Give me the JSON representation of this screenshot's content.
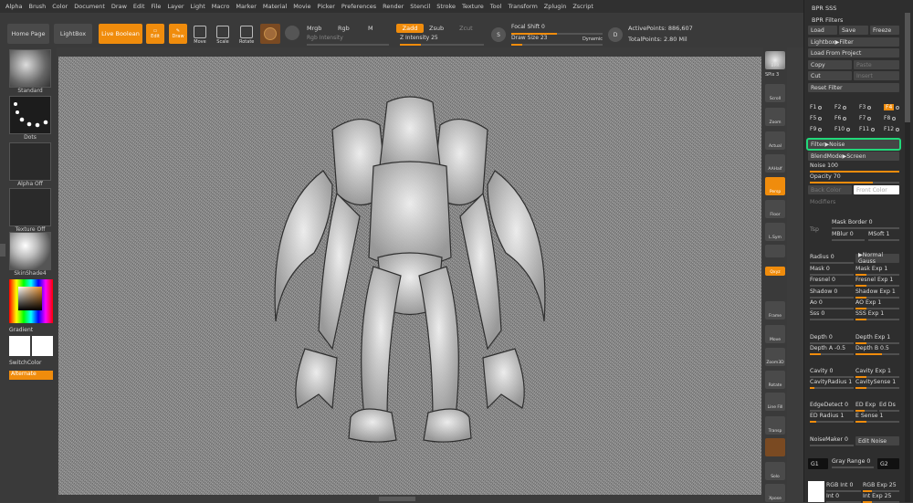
{
  "menu": [
    "Alpha",
    "Brush",
    "Color",
    "Document",
    "Draw",
    "Edit",
    "File",
    "Layer",
    "Light",
    "Macro",
    "Marker",
    "Material",
    "Movie",
    "Picker",
    "Preferences",
    "Render",
    "Stencil",
    "Stroke",
    "Texture",
    "Tool",
    "Transform",
    "Zplugin",
    "Zscript"
  ],
  "toolbar": {
    "home_page": "Home Page",
    "lightbox": "LightBox",
    "live_boolean": "Live Boolean",
    "edit": "Edit",
    "draw": "Draw",
    "move": "Move",
    "scale": "Scale",
    "rotate": "Rotate",
    "mrgb": "Mrgb",
    "rgb": "Rgb",
    "m": "M",
    "rgb_intensity": "Rgb Intensity",
    "zadd": "Zadd",
    "zsub": "Zsub",
    "zcut": "Zcut",
    "z_intensity": "Z Intensity",
    "z_intensity_value": "25",
    "z_intensity_level": 0.25,
    "focal_shift": "Focal Shift",
    "focal_shift_value": "0",
    "draw_size": "Draw Size",
    "draw_size_value": "23",
    "dynamic": "Dynamic",
    "active_points": "ActivePoints: 886,607",
    "total_points": "TotalPoints: 2.80 Mil"
  },
  "left_panel": {
    "brush": "Standard",
    "stroke": "Dots",
    "alpha": "Alpha Off",
    "texture": "Texture Off",
    "material": "SkinShade4",
    "gradient": "Gradient",
    "switch_color": "SwitchColor",
    "alternate": "Alternate"
  },
  "right_shelf": {
    "bpr": "BPR",
    "spix": "SPix 3",
    "scroll": "Scroll",
    "zoom": "Zoom",
    "actual": "Actual",
    "aahalf": "AAHalf",
    "persp": "Persp",
    "floor": "Floor",
    "lsym": "L.Sym",
    "xyz": "Qxyz",
    "frame": "Frame",
    "move": "Move",
    "zoom3d": "Zoom3D",
    "rotate": "Rotate",
    "line_fill": "Line Fill",
    "polyf": "PolyF",
    "transp": "Transp",
    "solo": "Solo",
    "xpose": "Xpose"
  },
  "tray": {
    "title": "BPR SSS",
    "section": "BPR Filters",
    "load": "Load",
    "save": "Save",
    "freeze": "Freeze",
    "lightbox_filter": "Lightbox▶Filter",
    "load_from_project": "Load From Project",
    "copy": "Copy",
    "paste": "Paste",
    "cut": "Cut",
    "insert": "Insert",
    "reset_filter": "Reset Filter",
    "filter_keys": [
      "F1",
      "F2",
      "F3",
      "F4",
      "F5",
      "F6",
      "F7",
      "F8",
      "F9",
      "F10",
      "F11",
      "F12"
    ],
    "filter_noise": "Filter▶Noise",
    "blendmode": "BlendMode▶Screen",
    "noise": "Noise 100",
    "noise_level": 1.0,
    "opacity": "Opacity 70",
    "opacity_level": 0.7,
    "back_color": "Back Color",
    "front_color": "Front Color",
    "modifiers": "Modifiers",
    "tsp": "Tsp",
    "mask_border": "Mask Border 0",
    "mblur": "MBlur 0",
    "msoft": "MSoft 1",
    "radius": "Radius 0",
    "normal_gauss": "▶Normal Gauss",
    "mask": "Mask 0",
    "mask_exp": "Mask Exp 1",
    "fresnel": "Fresnel 0",
    "fresnel_exp": "Fresnel Exp 1",
    "shadow": "Shadow 0",
    "shadow_exp": "Shadow Exp 1",
    "ao": "Ao 0",
    "ao_exp": "AO Exp 1",
    "sss": "Sss 0",
    "sss_exp": "SSS Exp 1",
    "depth": "Depth 0",
    "depth_exp": "Depth Exp 1",
    "depth_a": "Depth A -0.5",
    "depth_b": "Depth B 0.5",
    "cavity": "Cavity 0",
    "cavity_exp": "Cavity Exp 1",
    "cavity_radius": "CavityRadius 1",
    "cavity_sense": "CavitySense 1",
    "edge_detect": "EdgeDetect 0",
    "ed_exp": "ED Exp",
    "ed_ds": "Ed Ds",
    "ed_radius": "ED Radius 1",
    "e_sense": "E Sense 1",
    "noise_maker": "NoiseMaker 0",
    "edit_noise": "Edit Noise",
    "g1": "G1",
    "gray_range": "Gray Range 0",
    "g2": "G2",
    "rgb_int": "RGB Int 0",
    "rgb_exp": "RGB Exp 25",
    "int": "Int 0",
    "int_exp": "Int Exp 25"
  },
  "colors": {
    "accent": "#f08c0c",
    "highlight": "#22d87a"
  }
}
